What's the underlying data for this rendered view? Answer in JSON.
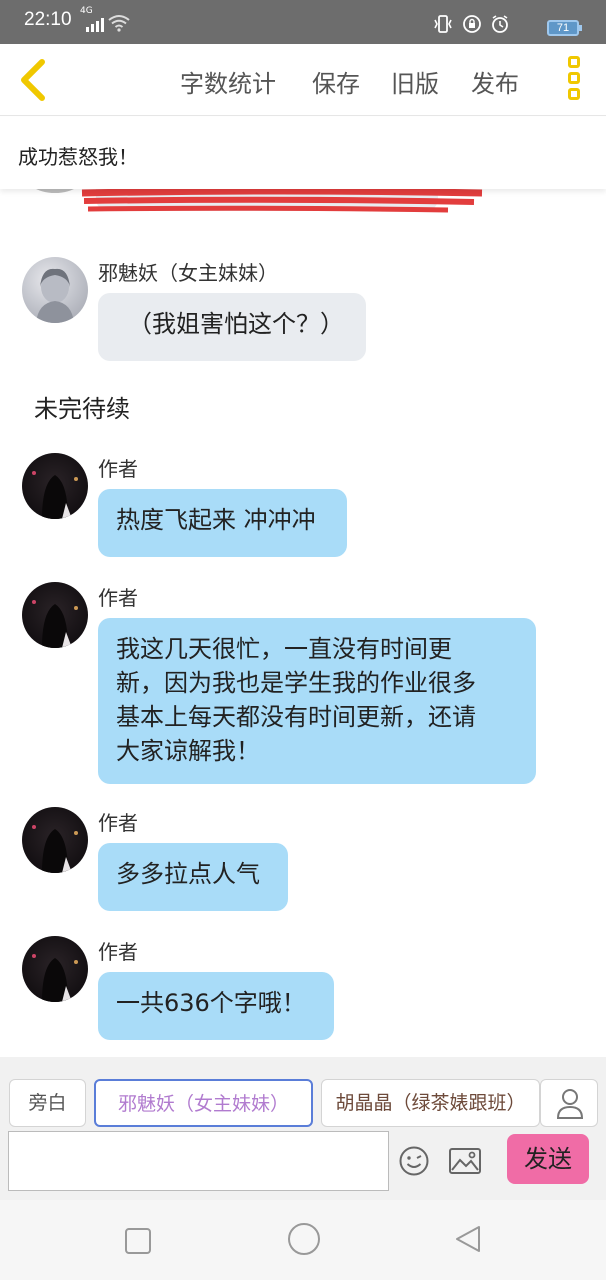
{
  "status_bar": {
    "time": "22:10",
    "network": "4G",
    "battery": "71"
  },
  "toolbar": {
    "word_count": "字数统计",
    "save": "保存",
    "old_version": "旧版",
    "publish": "发布"
  },
  "chapter_title": "成功惹怒我！",
  "messages": [
    {
      "sender": "邪魅妖（女主妹妹）",
      "text": "（我姐害怕这个？）"
    },
    {
      "narration": "未完待续"
    },
    {
      "sender": "作者",
      "text": "热度飞起来 冲冲冲"
    },
    {
      "sender": "作者",
      "text": "我这几天很忙，一直没有时间更\n新，因为我也是学生我的作业很多\n基本上每天都没有时间更新，还请\n大家谅解我！"
    },
    {
      "sender": "作者",
      "text": "多多拉点人气"
    },
    {
      "sender": "作者",
      "text": "一共636个字哦！"
    }
  ],
  "characters": [
    "旁白",
    "邪魅妖（女主妹妹）",
    "胡晶晶（绿茶婊跟班）"
  ],
  "input": {
    "placeholder": ""
  },
  "send_label": "发送",
  "colors": {
    "accent_yellow": "#f0c800",
    "bubble_blue": "#a9dcf8",
    "bubble_gray": "#e9ecf0",
    "send_pink": "#f06ca6"
  }
}
